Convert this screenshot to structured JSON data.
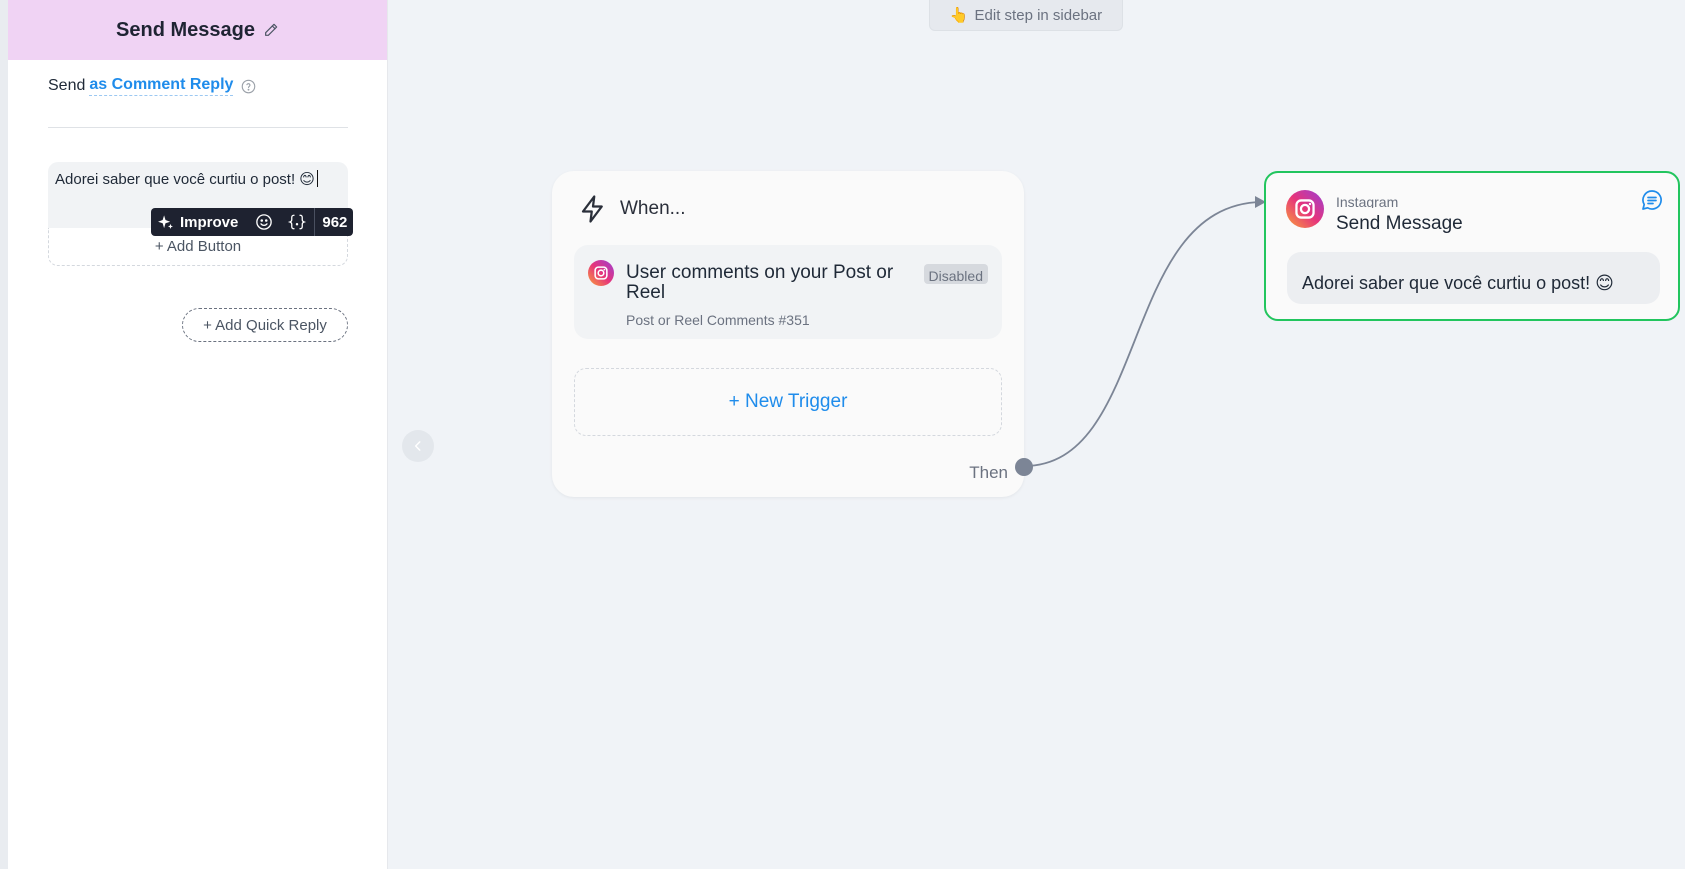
{
  "sidebar": {
    "title": "Send Message",
    "send_label": "Send",
    "send_mode": "as Comment Reply",
    "message_text": "Adorei saber que você curtiu o post! 😊",
    "toolbar": {
      "improve_label": "Improve",
      "char_count": "962"
    },
    "add_button_label": "+ Add Button",
    "add_quick_reply_label": "+ Add Quick Reply",
    "header_color": "#f0d3f4",
    "accent_color": "#1f8ceb"
  },
  "canvas": {
    "hint": {
      "emoji": "👆",
      "text": "Edit step in sidebar"
    },
    "trigger_card": {
      "heading": "When...",
      "trigger": {
        "title": "User comments on your Post or Reel",
        "subtitle": "Post or Reel Comments #351",
        "status": "Disabled",
        "icon": "instagram-icon"
      },
      "new_trigger_label": "+ New Trigger",
      "then_label": "Then"
    },
    "action_card": {
      "platform": "Instagram",
      "title": "Send Message",
      "message": "Adorei saber que você curtiu o post! 😊",
      "icon": "instagram-icon",
      "border_color": "#22c55e"
    }
  }
}
